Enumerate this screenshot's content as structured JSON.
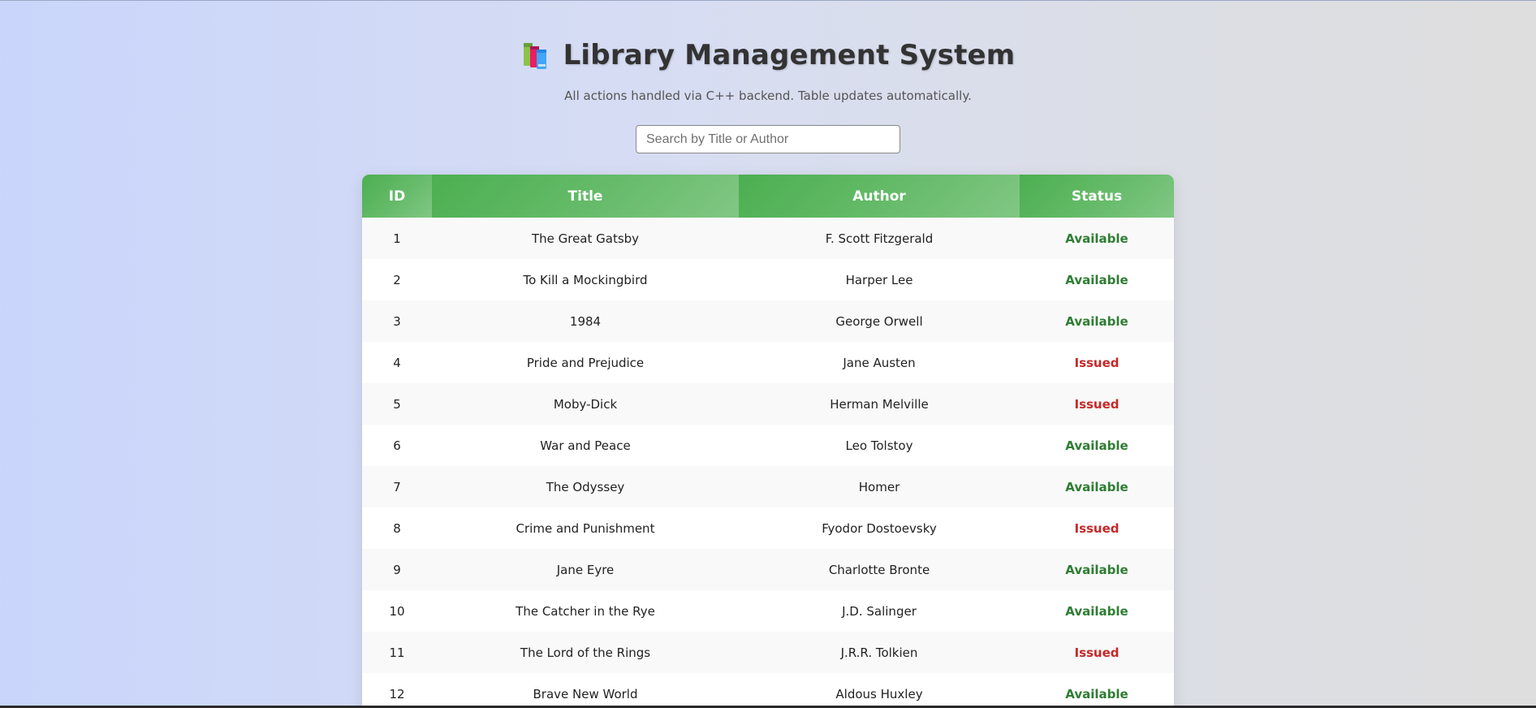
{
  "header": {
    "title": "Library Management System",
    "subtitle": "All actions handled via C++ backend. Table updates automatically.",
    "icon": "books-icon"
  },
  "search": {
    "placeholder": "Search by Title or Author",
    "value": ""
  },
  "colors": {
    "header_green": "#4caf50",
    "available": "#2e7d32",
    "issued": "#c62828"
  },
  "table": {
    "columns": [
      "ID",
      "Title",
      "Author",
      "Status"
    ],
    "rows": [
      {
        "id": "1",
        "title": "The Great Gatsby",
        "author": "F. Scott Fitzgerald",
        "status": "Available"
      },
      {
        "id": "2",
        "title": "To Kill a Mockingbird",
        "author": "Harper Lee",
        "status": "Available"
      },
      {
        "id": "3",
        "title": "1984",
        "author": "George Orwell",
        "status": "Available"
      },
      {
        "id": "4",
        "title": "Pride and Prejudice",
        "author": "Jane Austen",
        "status": "Issued"
      },
      {
        "id": "5",
        "title": "Moby-Dick",
        "author": "Herman Melville",
        "status": "Issued"
      },
      {
        "id": "6",
        "title": "War and Peace",
        "author": "Leo Tolstoy",
        "status": "Available"
      },
      {
        "id": "7",
        "title": "The Odyssey",
        "author": "Homer",
        "status": "Available"
      },
      {
        "id": "8",
        "title": "Crime and Punishment",
        "author": "Fyodor Dostoevsky",
        "status": "Issued"
      },
      {
        "id": "9",
        "title": "Jane Eyre",
        "author": "Charlotte Bronte",
        "status": "Available"
      },
      {
        "id": "10",
        "title": "The Catcher in the Rye",
        "author": "J.D. Salinger",
        "status": "Available"
      },
      {
        "id": "11",
        "title": "The Lord of the Rings",
        "author": "J.R.R. Tolkien",
        "status": "Issued"
      },
      {
        "id": "12",
        "title": "Brave New World",
        "author": "Aldous Huxley",
        "status": "Available"
      }
    ]
  }
}
